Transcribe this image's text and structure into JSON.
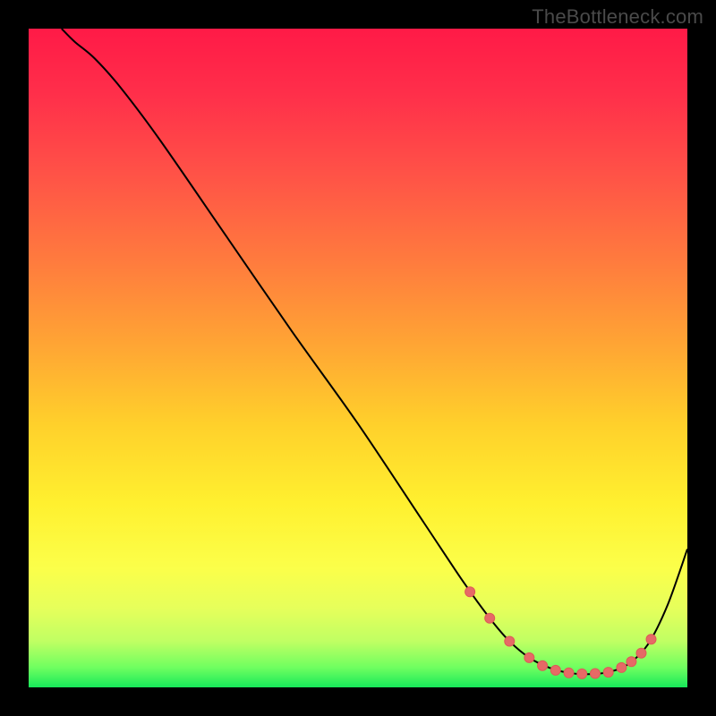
{
  "attribution": "TheBottleneck.com",
  "colors": {
    "frame": "#000000",
    "curve": "#000000",
    "marker_fill": "#e66a66",
    "marker_stroke": "#de5a57",
    "gradient_stops": [
      {
        "offset": 0.0,
        "color": "#ff1a47"
      },
      {
        "offset": 0.1,
        "color": "#ff2f4a"
      },
      {
        "offset": 0.22,
        "color": "#ff5247"
      },
      {
        "offset": 0.35,
        "color": "#ff7a3e"
      },
      {
        "offset": 0.48,
        "color": "#ffa534"
      },
      {
        "offset": 0.6,
        "color": "#ffd02b"
      },
      {
        "offset": 0.72,
        "color": "#fff02f"
      },
      {
        "offset": 0.82,
        "color": "#fbff4a"
      },
      {
        "offset": 0.88,
        "color": "#e6ff5b"
      },
      {
        "offset": 0.93,
        "color": "#c0ff63"
      },
      {
        "offset": 0.97,
        "color": "#6fff60"
      },
      {
        "offset": 1.0,
        "color": "#17e85a"
      }
    ]
  },
  "chart_data": {
    "type": "line",
    "title": "",
    "xlabel": "",
    "ylabel": "",
    "xlim": [
      0,
      100
    ],
    "ylim": [
      0,
      100
    ],
    "grid": false,
    "legend": false,
    "series": [
      {
        "name": "bottleneck-curve",
        "x": [
          5,
          7,
          10,
          14,
          20,
          30,
          40,
          50,
          60,
          66,
          70,
          73,
          76,
          79,
          82,
          85,
          88,
          91,
          94,
          97,
          100
        ],
        "y": [
          100,
          98,
          95.5,
          91,
          83,
          68.5,
          54,
          40,
          25,
          16,
          10.5,
          7,
          4.5,
          3,
          2.2,
          2,
          2.3,
          3.5,
          6.5,
          12.5,
          21
        ]
      }
    ],
    "markers": {
      "name": "optimal-range-dots",
      "x": [
        67,
        70,
        73,
        76,
        78,
        80,
        82,
        84,
        86,
        88,
        90,
        91.5,
        93,
        94.5
      ],
      "y": [
        14.5,
        10.5,
        7,
        4.5,
        3.3,
        2.6,
        2.2,
        2.05,
        2.1,
        2.3,
        3,
        3.9,
        5.2,
        7.3
      ]
    }
  }
}
